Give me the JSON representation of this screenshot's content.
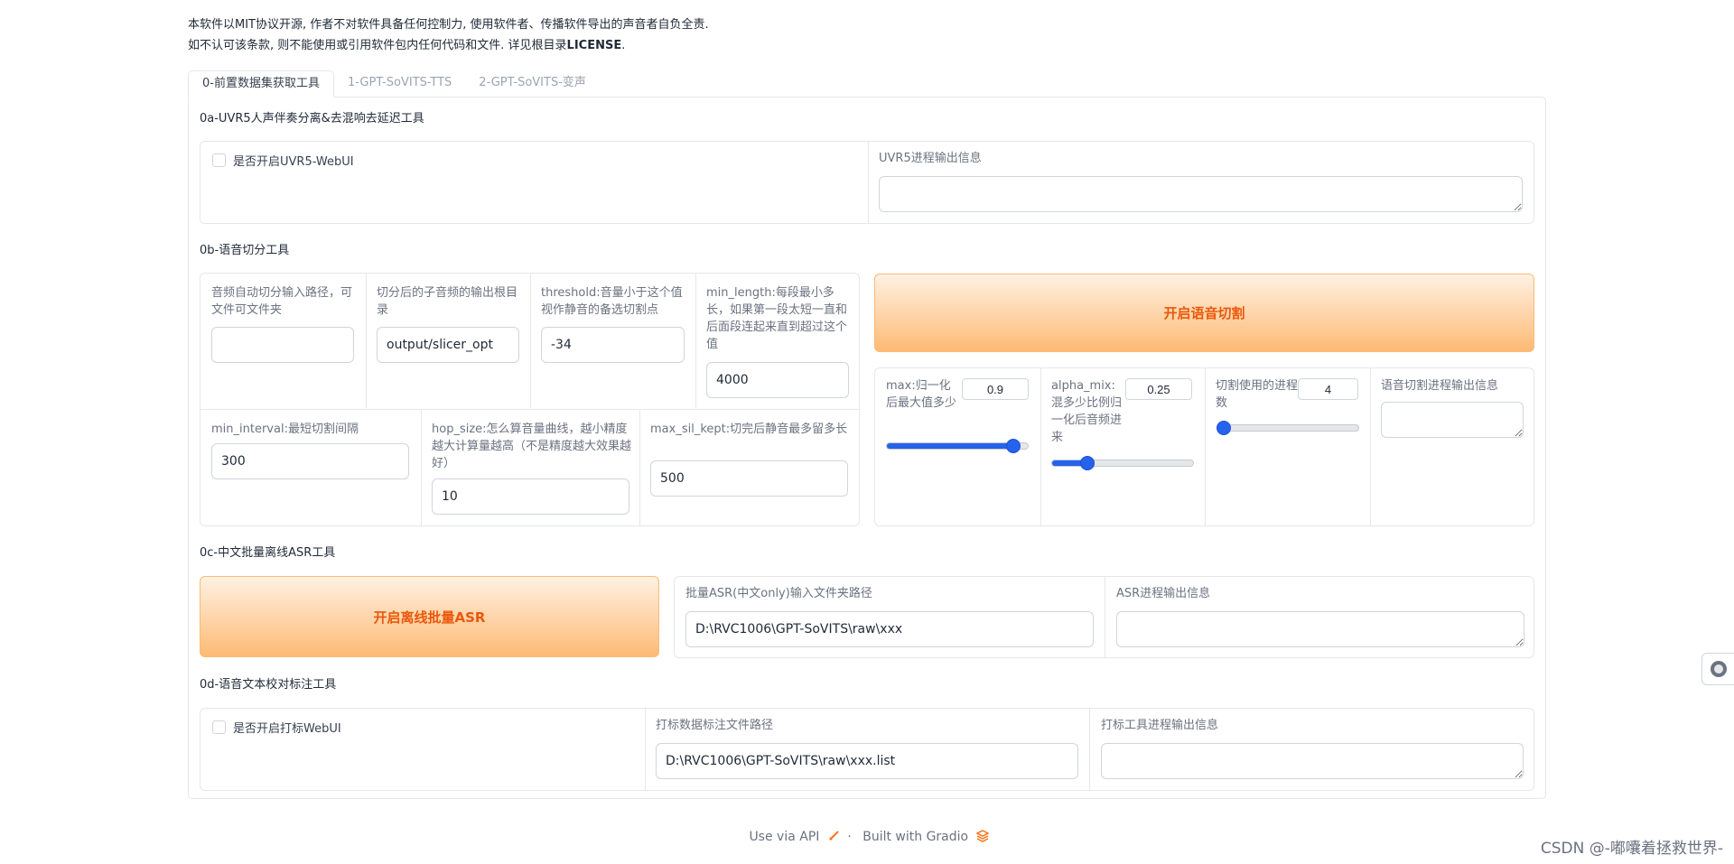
{
  "notice": {
    "line1": "本软件以MIT协议开源, 作者不对软件具备任何控制力, 使用软件者、传播软件导出的声音者自负全责.",
    "line2_prefix": "如不认可该条款, 则不能使用或引用软件包内任何代码和文件. 详见根目录",
    "line2_bold": "LICENSE",
    "line2_suffix": "."
  },
  "tabs": [
    {
      "label": "0-前置数据集获取工具",
      "active": true
    },
    {
      "label": "1-GPT-SoVITS-TTS",
      "active": false
    },
    {
      "label": "2-GPT-SoVITS-变声",
      "active": false
    }
  ],
  "uvr5": {
    "title": "0a-UVR5人声伴奏分离&去混响去延迟工具",
    "checkbox_label": "是否开启UVR5-WebUI",
    "output_label": "UVR5进程输出信息",
    "output_value": ""
  },
  "slicer": {
    "title": "0b-语音切分工具",
    "input_path_label": "音频自动切分输入路径，可文件可文件夹",
    "input_path_value": "",
    "output_root_label": "切分后的子音频的输出根目录",
    "output_root_value": "output/slicer_opt",
    "threshold_label": "threshold:音量小于这个值视作静音的备选切割点",
    "threshold_value": "-34",
    "min_length_label": "min_length:每段最小多长，如果第一段太短一直和后面段连起来直到超过这个值",
    "min_length_value": "4000",
    "min_interval_label": "min_interval:最短切割间隔",
    "min_interval_value": "300",
    "hop_size_label": "hop_size:怎么算音量曲线，越小精度越大计算量越高（不是精度越大效果越好）",
    "hop_size_value": "10",
    "max_sil_kept_label": "max_sil_kept:切完后静音最多留多长",
    "max_sil_kept_value": "500",
    "start_button": "开启语音切割",
    "max_label": "max:归一化后最大值多少",
    "max_value": "0.9",
    "max_fraction": 0.9,
    "alpha_label": "alpha_mix:混多少比例归一化后音频进来",
    "alpha_value": "0.25",
    "alpha_fraction": 0.25,
    "procs_label": "切割使用的进程数",
    "procs_value": "4",
    "procs_fraction": 0.0,
    "output_label": "语音切割进程输出信息",
    "output_value": ""
  },
  "asr": {
    "title": "0c-中文批量离线ASR工具",
    "start_button": "开启离线批量ASR",
    "input_label": "批量ASR(中文only)输入文件夹路径",
    "input_value": "D:\\RVC1006\\GPT-SoVITS\\raw\\xxx",
    "output_label": "ASR进程输出信息",
    "output_value": ""
  },
  "labeling": {
    "title": "0d-语音文本校对标注工具",
    "checkbox_label": "是否开启打标WebUI",
    "path_label": "打标数据标注文件路径",
    "path_value": "D:\\RVC1006\\GPT-SoVITS\\raw\\xxx.list",
    "output_label": "打标工具进程输出信息",
    "output_value": ""
  },
  "footer": {
    "api": "Use via API",
    "sep": "·",
    "built": "Built with Gradio"
  },
  "watermark": "CSDN @-嘟囔着拯救世界-",
  "colors": {
    "accent_orange": "#ea580c",
    "slider_blue": "#2563eb"
  }
}
